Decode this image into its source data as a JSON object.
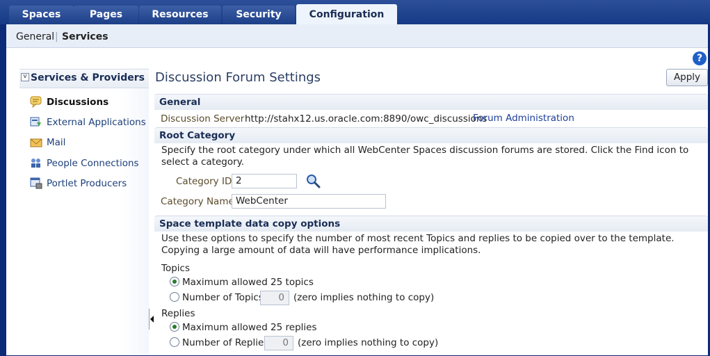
{
  "tabs": [
    {
      "label": "Spaces"
    },
    {
      "label": "Pages"
    },
    {
      "label": "Resources"
    },
    {
      "label": "Security"
    },
    {
      "label": "Configuration"
    }
  ],
  "subnav": {
    "general": "General",
    "services": "Services"
  },
  "help_label": "?",
  "nav": {
    "header": "Services & Providers",
    "items": [
      {
        "label": "Discussions"
      },
      {
        "label": "External Applications"
      },
      {
        "label": "Mail"
      },
      {
        "label": "People Connections"
      },
      {
        "label": "Portlet Producers"
      }
    ]
  },
  "main": {
    "title": "Discussion Forum Settings",
    "apply": "Apply",
    "general": {
      "header": "General",
      "server_label": "Discussion Server",
      "server_value": "http://stahx12.us.oracle.com:8890/owc_discussions",
      "forum_admin_link": "Forum Administration"
    },
    "root_category": {
      "header": "Root Category",
      "description": "Specify the root category under which all WebCenter Spaces discussion forums are stored. Click the Find icon to select a category.",
      "category_id_label": "Category ID",
      "category_id_value": "2",
      "category_name_label": "Category Name",
      "category_name_value": "WebCenter"
    },
    "copy_options": {
      "header": "Space template data copy options",
      "description": "Use these options to specify the number of most recent Topics and replies to be copied over to the template. Copying a large amount of data will have performance implications.",
      "topics_label": "Topics",
      "topics_max": "Maximum allowed 25 topics",
      "topics_number": "Number of Topics",
      "topics_value": "0",
      "topics_hint": "(zero implies nothing to copy)",
      "replies_label": "Replies",
      "replies_max": "Maximum allowed 25 replies",
      "replies_number": "Number of Replies",
      "replies_value": "0",
      "replies_hint": "(zero implies nothing to copy)"
    }
  }
}
